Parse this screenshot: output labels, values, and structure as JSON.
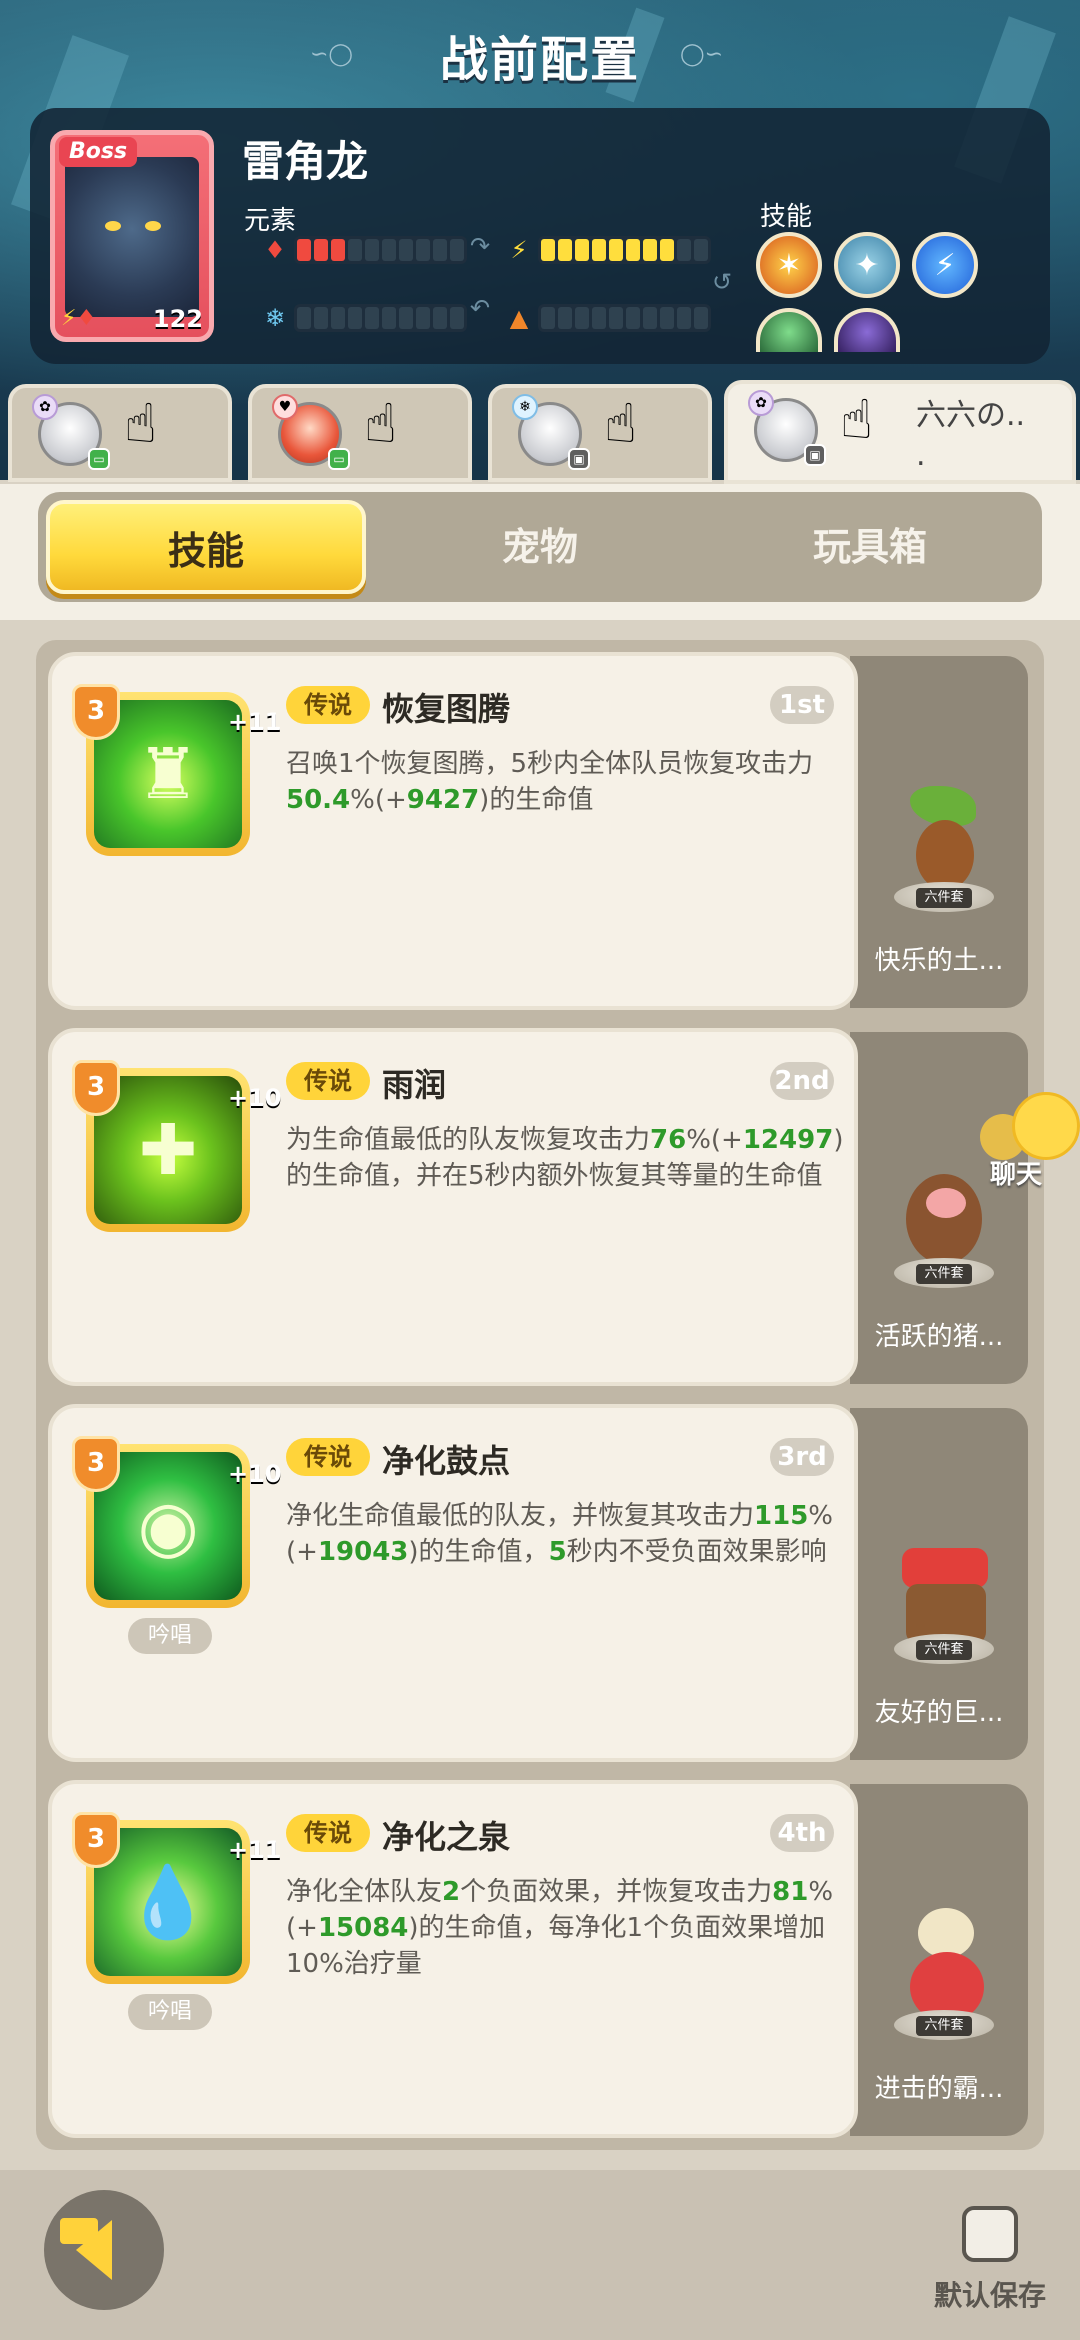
{
  "header": {
    "title": "战前配置"
  },
  "boss": {
    "tag": "Boss",
    "name": "雷角龙",
    "level": "122",
    "element_label": "元素",
    "skill_label": "技能",
    "stats": [
      {
        "icon": "fire-icon",
        "filled": 3,
        "total": 10,
        "color": "#f04a3f"
      },
      {
        "icon": "lightning-icon",
        "filled": 8,
        "total": 10,
        "color": "#ffde3d"
      },
      {
        "icon": "snowflake-icon",
        "filled": 0,
        "total": 10,
        "color": "#6fc8f0"
      },
      {
        "icon": "earth-icon",
        "filled": 0,
        "total": 10,
        "color": "#f0862a"
      }
    ]
  },
  "heroes": [
    {
      "name": "",
      "active": false
    },
    {
      "name": "",
      "active": false
    },
    {
      "name": "",
      "active": false
    },
    {
      "name": "六六の..\n.",
      "active": true
    }
  ],
  "tabs": [
    {
      "label": "技能",
      "active": true
    },
    {
      "label": "宠物",
      "active": false
    },
    {
      "label": "玩具箱",
      "active": false
    }
  ],
  "skills": [
    {
      "rank": "3",
      "plus": "+11",
      "legend": "传说",
      "name": "恢复图腾",
      "order": "1st",
      "desc_parts": [
        "召唤1个恢复图腾，5秒内全体队员恢复攻击力",
        "50.4",
        "%(+",
        "9427",
        ")的生命值"
      ],
      "chant": "",
      "pet_name": "快乐的土...",
      "pet_set": "六件套"
    },
    {
      "rank": "3",
      "plus": "+10",
      "legend": "传说",
      "name": "雨润",
      "order": "2nd",
      "desc_parts": [
        "为生命值最低的队友恢复攻击力",
        "76",
        "%(+",
        "12497",
        ")的生命值，并在5秒内额外恢复其等量的生命值"
      ],
      "chant": "",
      "pet_name": "活跃的猪...",
      "pet_set": "六件套"
    },
    {
      "rank": "3",
      "plus": "+10",
      "legend": "传说",
      "name": "净化鼓点",
      "order": "3rd",
      "desc_parts": [
        "净化生命值最低的队友，并恢复其攻击力",
        "115",
        "%(+",
        "19043",
        ")的生命值，",
        "5",
        "秒内不受负面效果影响"
      ],
      "chant": "吟唱",
      "pet_name": "友好的巨...",
      "pet_set": "六件套"
    },
    {
      "rank": "3",
      "plus": "+11",
      "legend": "传说",
      "name": "净化之泉",
      "order": "4th",
      "desc_parts": [
        "净化全体队友",
        "2",
        "个负面效果，并恢复攻击力",
        "81",
        "%(+",
        "15084",
        ")的生命值，每净化1个负面效果增加10%治疗量"
      ],
      "chant": "吟唱",
      "pet_name": "进击的霸...",
      "pet_set": "六件套"
    }
  ],
  "chat": {
    "label": "聊天"
  },
  "bottom": {
    "save_label": "默认保存"
  }
}
